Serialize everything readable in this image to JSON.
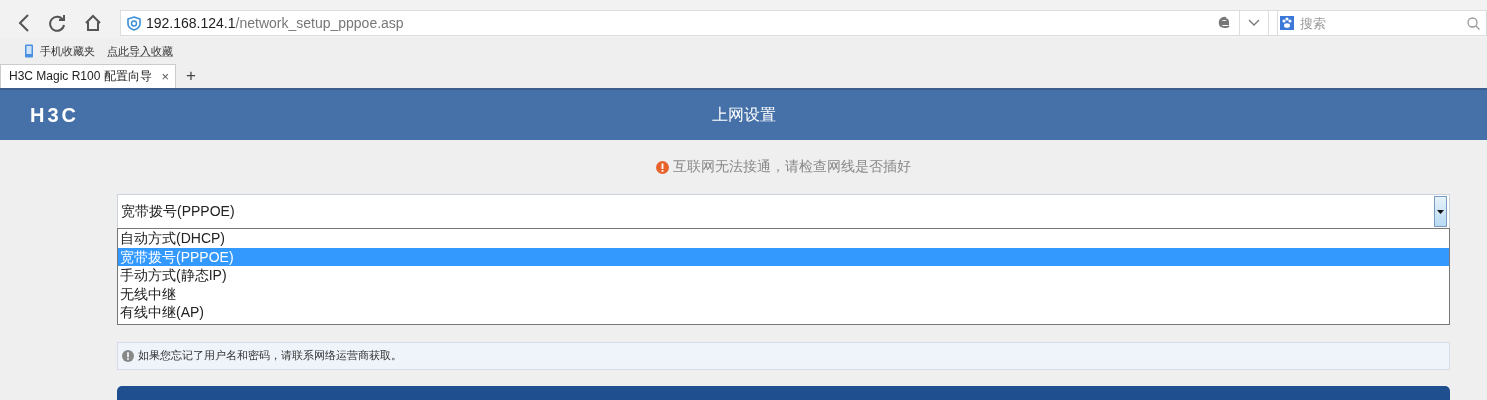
{
  "browser": {
    "address": {
      "host": "192.168.124.1",
      "path": "/network_setup_pppoe.asp"
    },
    "search": {
      "placeholder": "搜索"
    },
    "bookmarks": [
      "手机收藏夹",
      "点此导入收藏"
    ],
    "tabs": [
      {
        "label": "H3C Magic R100 配置向导",
        "selected": true,
        "close": "×"
      }
    ],
    "new_tab": "+"
  },
  "header": {
    "logo": "H3C",
    "title": "上网设置"
  },
  "alert": "互联网无法接通，请检查网线是否插好",
  "connection_select": {
    "value": "宽带拨号(PPPOE)",
    "expanded": true,
    "options": [
      {
        "label": "自动方式(DHCP)",
        "selected": false
      },
      {
        "label": "宽带拨号(PPPOE)",
        "selected": true
      },
      {
        "label": "手动方式(静态IP)",
        "selected": false
      },
      {
        "label": "无线中继",
        "selected": false
      },
      {
        "label": "有线中继(AP)",
        "selected": false
      }
    ]
  },
  "hint": "如果您忘记了用户名和密码，请联系网络运营商获取。",
  "submit_button": {
    "kind": "primary"
  }
}
